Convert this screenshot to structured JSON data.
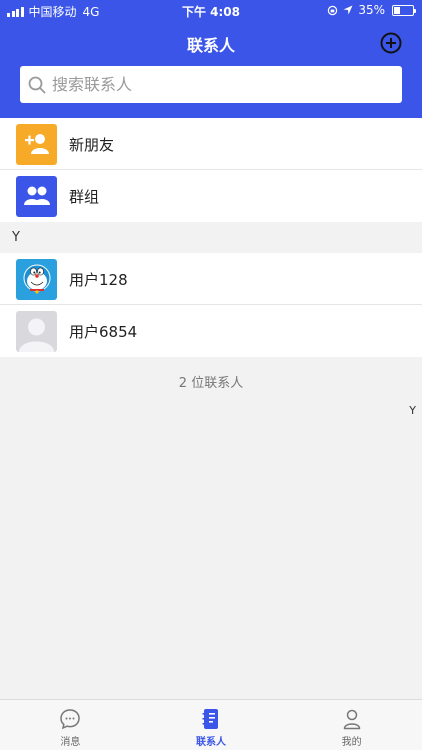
{
  "status_bar": {
    "carrier": "中国移动",
    "network": "4G",
    "time": "下午 4:08",
    "battery": "35%",
    "battery_level": 0.35
  },
  "header": {
    "title": "联系人"
  },
  "search": {
    "placeholder": "搜索联系人"
  },
  "top_items": [
    {
      "label": "新朋友",
      "icon": "add-user-icon",
      "color": "#f7a928"
    },
    {
      "label": "群组",
      "icon": "group-icon",
      "color": "#3a55e8"
    }
  ],
  "section": {
    "letter": "Y"
  },
  "contacts": [
    {
      "name": "用户128",
      "avatar": "doraemon-avatar"
    },
    {
      "name": "用户6854",
      "avatar": "default-person-avatar"
    }
  ],
  "contact_count": "2 位联系人",
  "index_bar": {
    "letters": [
      "Y"
    ]
  },
  "tabs": [
    {
      "label": "消息",
      "icon": "chat-bubble-icon",
      "active": false
    },
    {
      "label": "联系人",
      "icon": "contacts-book-icon",
      "active": true
    },
    {
      "label": "我的",
      "icon": "person-icon",
      "active": false
    }
  ],
  "colors": {
    "accent": "#3a55e8",
    "new_friend": "#f7a928",
    "background": "#f2f2f2"
  }
}
